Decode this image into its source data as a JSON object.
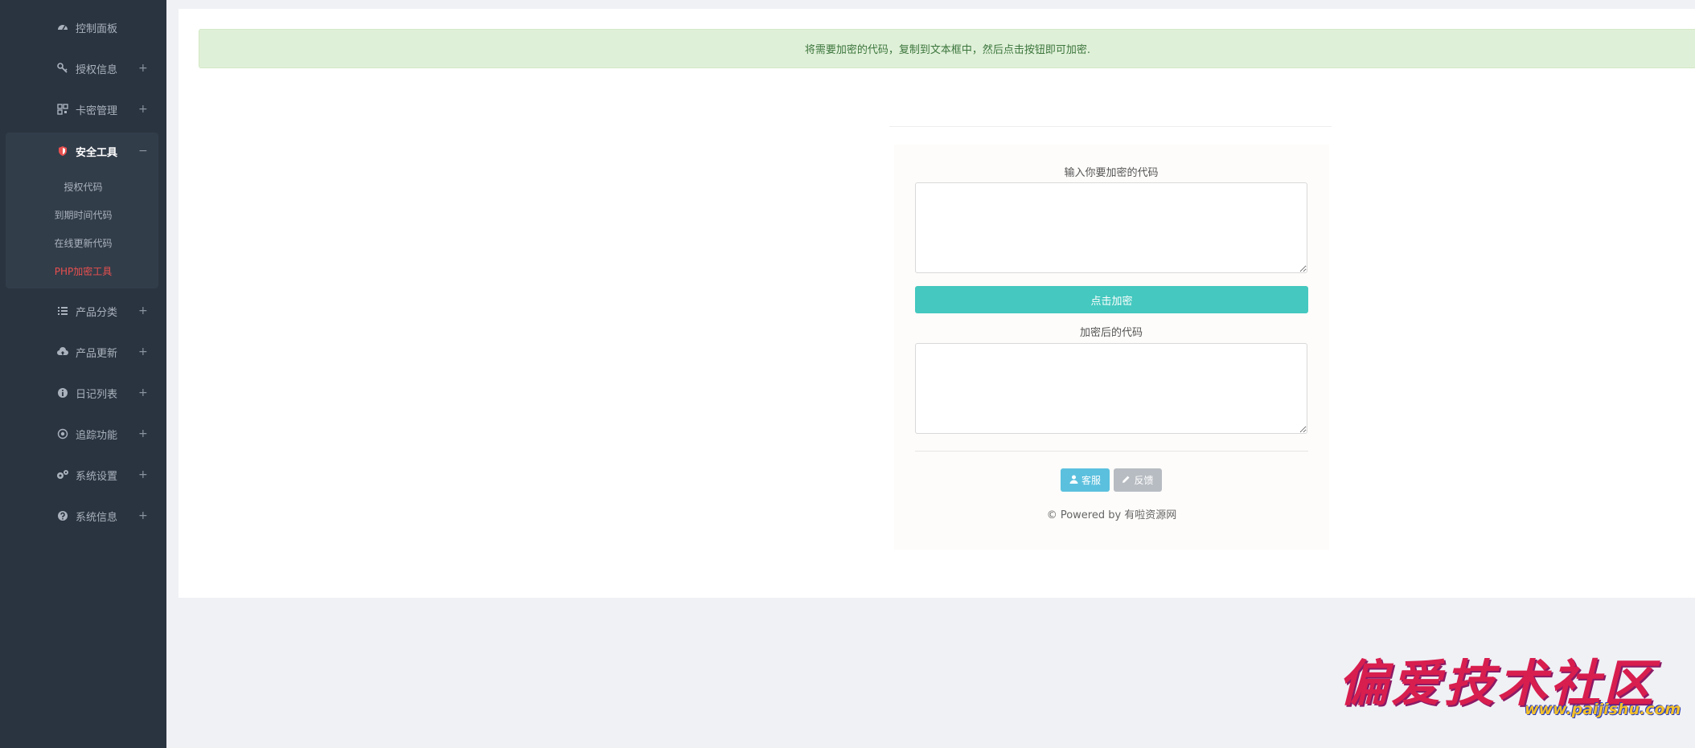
{
  "sidebar": {
    "items": [
      {
        "label": "控制面板",
        "icon": "dashboard-icon",
        "toggle": ""
      },
      {
        "label": "授权信息",
        "icon": "key-icon",
        "toggle": "+"
      },
      {
        "label": "卡密管理",
        "icon": "qrcode-icon",
        "toggle": "+"
      },
      {
        "label": "安全工具",
        "icon": "shield-icon",
        "toggle": "−"
      },
      {
        "label": "产品分类",
        "icon": "list-icon",
        "toggle": "+"
      },
      {
        "label": "产品更新",
        "icon": "cloud-upload-icon",
        "toggle": "+"
      },
      {
        "label": "日记列表",
        "icon": "info-icon",
        "toggle": "+"
      },
      {
        "label": "追踪功能",
        "icon": "target-icon",
        "toggle": "+"
      },
      {
        "label": "系统设置",
        "icon": "gears-icon",
        "toggle": "+"
      },
      {
        "label": "系统信息",
        "icon": "question-icon",
        "toggle": "+"
      }
    ],
    "subitems": [
      {
        "label": "授权代码"
      },
      {
        "label": "到期时间代码"
      },
      {
        "label": "在线更新代码"
      },
      {
        "label": "PHP加密工具"
      }
    ]
  },
  "main": {
    "alert": "将需要加密的代码，复制到文本框中，然后点击按钮即可加密.",
    "input_label": "输入你要加密的代码",
    "encrypt_button": "点击加密",
    "output_label": "加密后的代码",
    "service_button": "客服",
    "feedback_button": "反馈",
    "footer": "© Powered by 有啦资源网"
  },
  "watermark": {
    "title": "偏爱技术社区",
    "url": "www.paijishu.com"
  },
  "colors": {
    "sidebar_bg": "#2a3440",
    "active_red": "#e8504e",
    "teal_button": "#44c8bf",
    "alert_bg": "#dff0d8",
    "alert_text": "#3c763d",
    "service_blue": "#5bc0de",
    "feedback_gray": "#b7bcc2"
  }
}
